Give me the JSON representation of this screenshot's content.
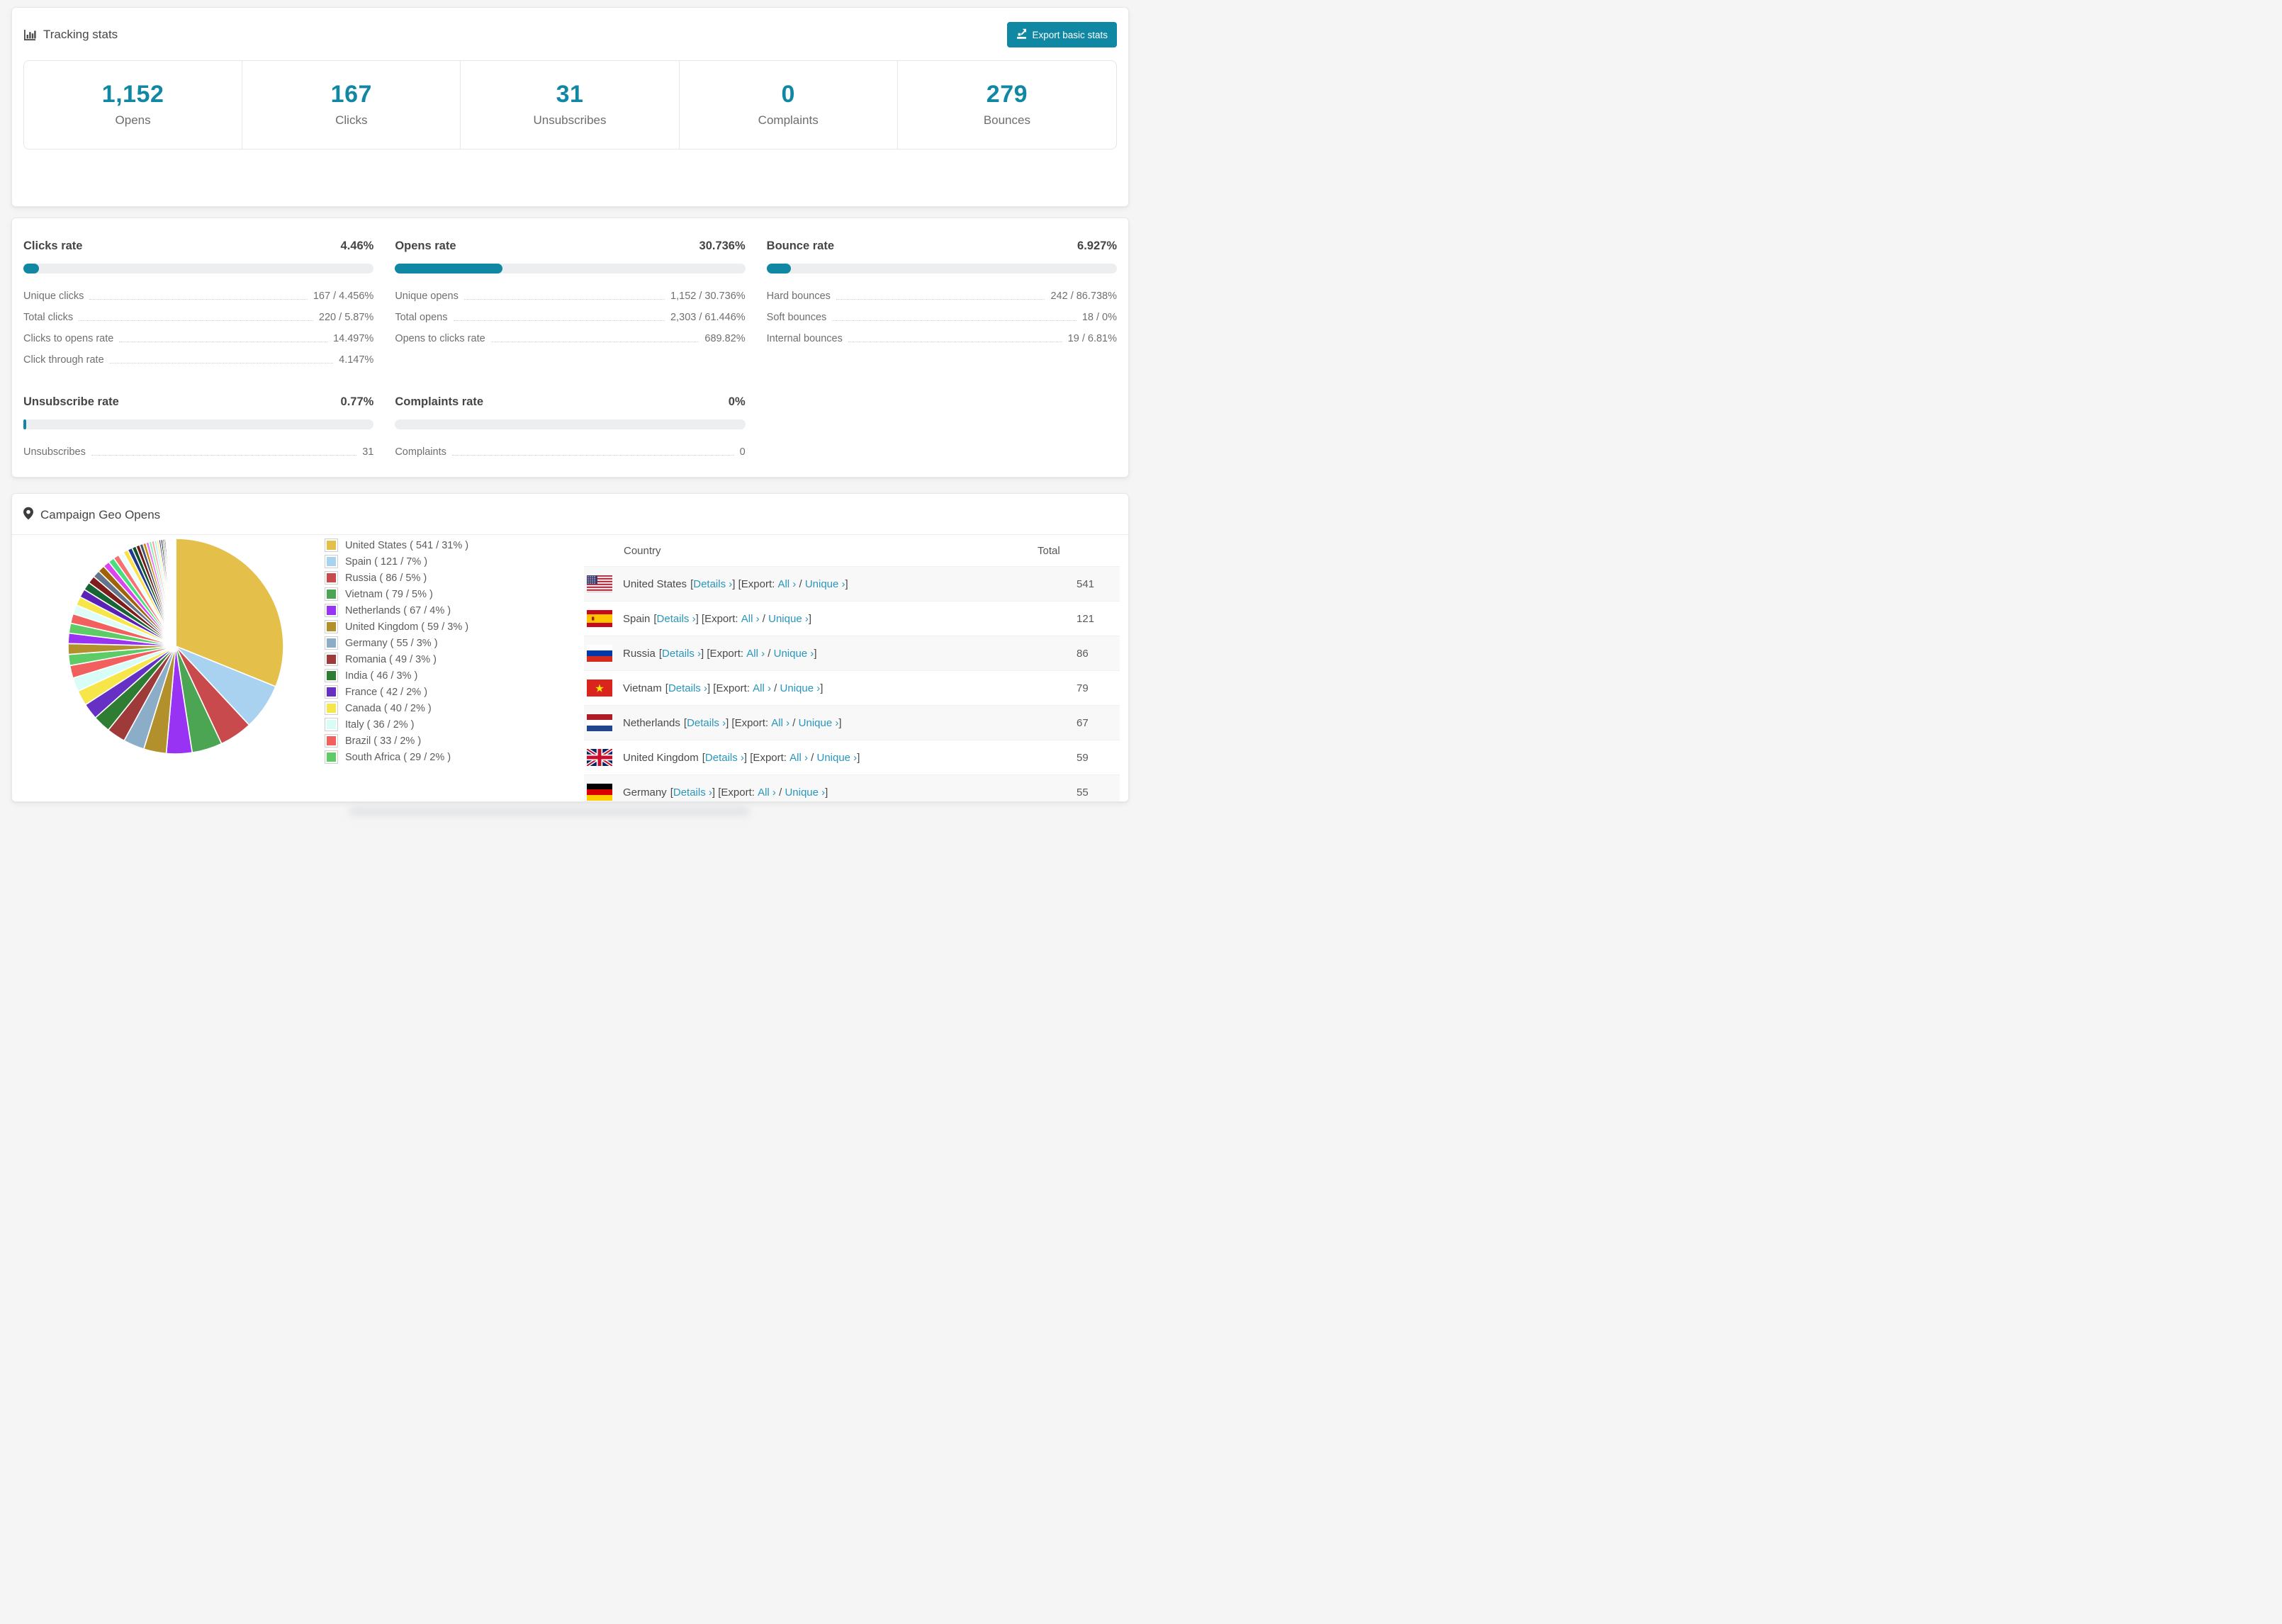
{
  "accent_color": "#1088a3",
  "link_color": "#2996bb",
  "tracking": {
    "title": "Tracking stats",
    "export_button": "Export basic stats",
    "stats": [
      {
        "value": "1,152",
        "label": "Opens"
      },
      {
        "value": "167",
        "label": "Clicks"
      },
      {
        "value": "31",
        "label": "Unsubscribes"
      },
      {
        "value": "0",
        "label": "Complaints"
      },
      {
        "value": "279",
        "label": "Bounces"
      }
    ]
  },
  "rates": [
    {
      "title": "Clicks rate",
      "value": "4.46%",
      "percent": 4.46,
      "rows": [
        {
          "label": "Unique clicks",
          "value": "167 / 4.456%"
        },
        {
          "label": "Total clicks",
          "value": "220 / 5.87%"
        },
        {
          "label": "Clicks to opens rate",
          "value": "14.497%"
        },
        {
          "label": "Click through rate",
          "value": "4.147%"
        }
      ]
    },
    {
      "title": "Opens rate",
      "value": "30.736%",
      "percent": 30.736,
      "rows": [
        {
          "label": "Unique opens",
          "value": "1,152 / 30.736%"
        },
        {
          "label": "Total opens",
          "value": "2,303 / 61.446%"
        },
        {
          "label": "Opens to clicks rate",
          "value": "689.82%"
        }
      ]
    },
    {
      "title": "Bounce rate",
      "value": "6.927%",
      "percent": 6.927,
      "rows": [
        {
          "label": "Hard bounces",
          "value": "242 / 86.738%"
        },
        {
          "label": "Soft bounces",
          "value": "18 / 0%"
        },
        {
          "label": "Internal bounces",
          "value": "19 / 6.81%"
        }
      ]
    },
    {
      "title": "Unsubscribe rate",
      "value": "0.77%",
      "percent": 0.77,
      "rows": [
        {
          "label": "Unsubscribes",
          "value": "31"
        }
      ]
    },
    {
      "title": "Complaints rate",
      "value": "0%",
      "percent": 0,
      "rows": [
        {
          "label": "Complaints",
          "value": "0"
        }
      ]
    }
  ],
  "geo": {
    "title": "Campaign Geo Opens",
    "table": {
      "col_country": "Country",
      "col_total": "Total",
      "details_link": "Details ›",
      "export_prefix": "[Export:",
      "all_link": "All ›",
      "unique_link": "Unique ›",
      "rows": [
        {
          "country": "United States",
          "flag": "us",
          "total": "541"
        },
        {
          "country": "Spain",
          "flag": "es",
          "total": "121"
        },
        {
          "country": "Russia",
          "flag": "ru",
          "total": "86"
        },
        {
          "country": "Vietnam",
          "flag": "vn",
          "total": "79"
        },
        {
          "country": "Netherlands",
          "flag": "nl",
          "total": "67"
        },
        {
          "country": "United Kingdom",
          "flag": "gb",
          "total": "59"
        },
        {
          "country": "Germany",
          "flag": "de",
          "total": "55"
        }
      ]
    }
  },
  "chart_data": {
    "type": "pie",
    "title": "Campaign Geo Opens",
    "legend_position": "right",
    "labels": [
      "United States",
      "Spain",
      "Russia",
      "Vietnam",
      "Netherlands",
      "United Kingdom",
      "Germany",
      "Romania",
      "India",
      "France",
      "Canada",
      "Italy",
      "Brazil",
      "South Africa"
    ],
    "values": [
      541,
      121,
      86,
      79,
      67,
      59,
      55,
      49,
      46,
      42,
      40,
      36,
      33,
      29
    ],
    "percents": [
      31,
      7,
      5,
      5,
      4,
      3,
      3,
      3,
      3,
      2,
      2,
      2,
      2,
      2
    ],
    "colors": [
      "#e4c04a",
      "#a8d2f0",
      "#c94a4c",
      "#4ca553",
      "#9933f3",
      "#b2902c",
      "#8cadc8",
      "#9e3a3a",
      "#2e7d33",
      "#6630c4",
      "#f7e64a",
      "#d8fcf6",
      "#f15f5f",
      "#5ecc66"
    ],
    "others_values": [
      28,
      27,
      26,
      25,
      24,
      23,
      22,
      21,
      20,
      19,
      18,
      17,
      16,
      15,
      14,
      13,
      12,
      11,
      10,
      9,
      8,
      8,
      7,
      7,
      6,
      6,
      5,
      5,
      4,
      4,
      3,
      3,
      3,
      2,
      2,
      2,
      2,
      1,
      1,
      1,
      1,
      1,
      1,
      1,
      1,
      1
    ]
  }
}
